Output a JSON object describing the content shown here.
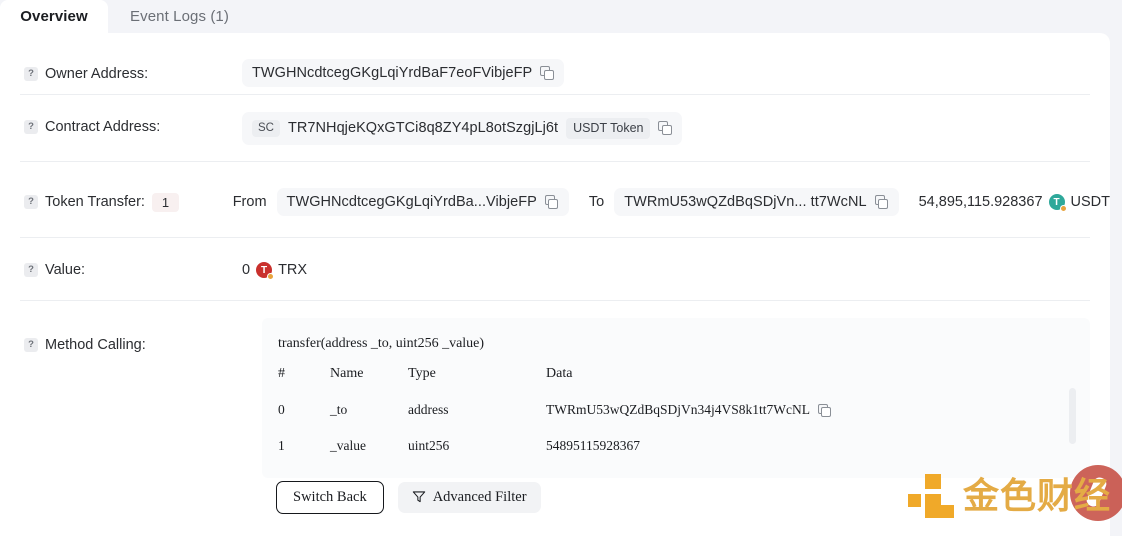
{
  "tabs": [
    {
      "label": "Overview",
      "active": true
    },
    {
      "label": "Event Logs (1)",
      "active": false
    }
  ],
  "rows": {
    "owner_address": {
      "label": "Owner Address:",
      "value": "TWGHNcdtcegGKgLqiYrdBaF7eoFVibjeFP"
    },
    "contract_address": {
      "label": "Contract Address:",
      "tag": "SC",
      "value": "TR7NHqjeKQxGTCi8q8ZY4pL8otSzgjLj6t",
      "token_tag": "USDT Token"
    },
    "token_transfer": {
      "label": "Token Transfer:",
      "count": "1",
      "from_label": "From",
      "from_value": "TWGHNcdtcegGKgLqiYrdBa...VibjeFP",
      "to_label": "To",
      "to_value": "TWRmU53wQZdBqSDjVn... tt7WcNL",
      "amount": "54,895,115.928367",
      "symbol": "USDT",
      "coin_glyph": "T"
    },
    "value": {
      "label": "Value:",
      "amount": "0",
      "symbol": "TRX",
      "coin_glyph": "T"
    },
    "method_calling": {
      "label": "Method Calling:",
      "signature": "transfer(address _to, uint256 _value)",
      "columns": [
        "#",
        "Name",
        "Type",
        "Data"
      ],
      "params": [
        {
          "index": "0",
          "name": "_to",
          "type": "address",
          "data": "TWRmU53wQZdBqSDjVn34j4VS8k1tt7WcNL",
          "copyable": true
        },
        {
          "index": "1",
          "name": "_value",
          "type": "uint256",
          "data": "54895115928367",
          "copyable": false
        }
      ]
    }
  },
  "buttons": {
    "switch_back": "Switch Back",
    "advanced_filter": "Advanced Filter"
  },
  "watermark": {
    "text": "金色财经"
  },
  "colors": {
    "page_bg": "#f3f4f8",
    "card_bg": "#ffffff",
    "chip_bg": "#f6f7f9",
    "usdt": "#2ea89a",
    "trx": "#c9302c",
    "watermark_orange": "#e3a73c"
  }
}
